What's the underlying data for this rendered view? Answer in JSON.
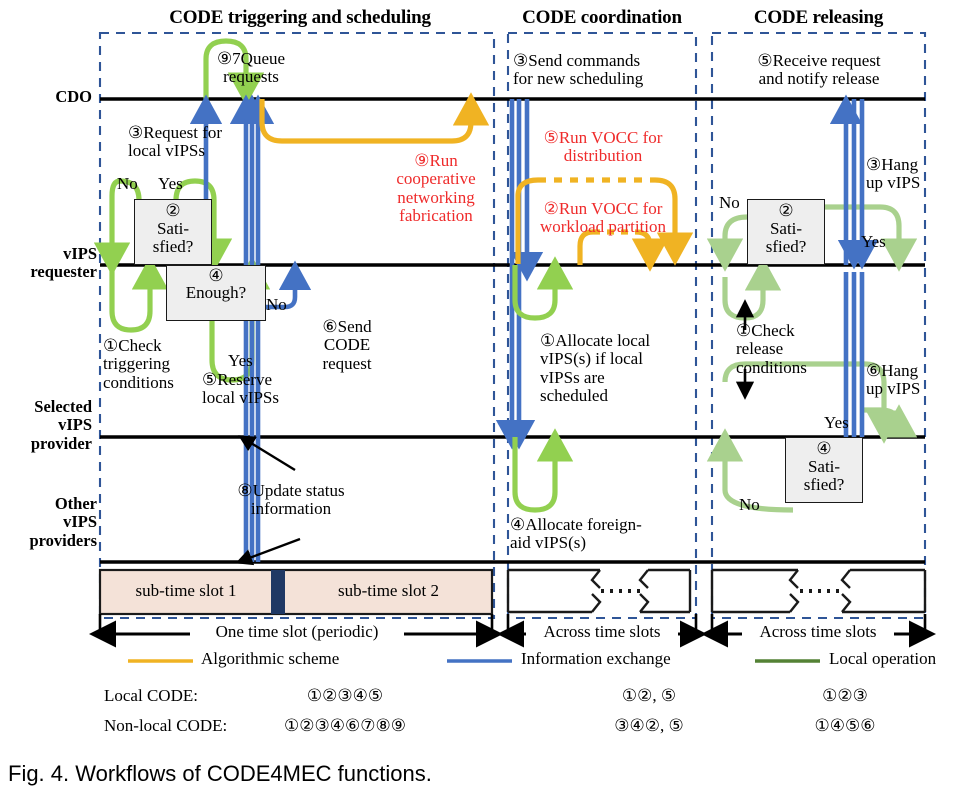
{
  "figure": {
    "caption": "Fig. 4. Workflows of CODE4MEC functions."
  },
  "colors": {
    "algorithmic": "#f0b323",
    "information": "#4472c4",
    "local_operation": "#92d050",
    "local_operation_light": "#a9d18e",
    "legend_local_operation": "#548235",
    "panel_border": "#2f5597",
    "slot_fill": "#f4e2d8",
    "slot_divider": "#1f3864",
    "red_text": "#ef2b2b",
    "line": "#000000"
  },
  "panels": [
    {
      "id": "triggering",
      "title": "CODE triggering and scheduling"
    },
    {
      "id": "coordination",
      "title": "CODE coordination"
    },
    {
      "id": "releasing",
      "title": "CODE releasing"
    }
  ],
  "lifelines": [
    {
      "id": "cdo",
      "label": "CDO"
    },
    {
      "id": "vips-requester",
      "label": "vIPS\nrequester"
    },
    {
      "id": "selected-vips-provider",
      "label": "Selected\nvIPS\nprovider"
    },
    {
      "id": "other-vips-providers",
      "label": "Other\nvIPS\nproviders"
    }
  ],
  "panel1": {
    "steps": {
      "queue_requests": "⑨7Queue\nrequests",
      "request_local_vips": "③Request for\nlocal vIPSs",
      "run_cooperative": "⑨Run\ncooperative\nnetworking\nfabrication",
      "check_triggering": "①Check\ntriggering\nconditions",
      "reserve_local": "⑤Reserve\nlocal vIPSs",
      "send_code_request": "⑥Send\nCODE\nrequest",
      "update_status": "⑧Update status\ninformation"
    },
    "decisions": [
      {
        "id": "satisfied",
        "number": "②",
        "label": "Sati-\nsfied?"
      },
      {
        "id": "enough",
        "number": "④",
        "label": "Enough?"
      }
    ],
    "branches": {
      "no1": "No",
      "yes1": "Yes",
      "yes2": "Yes",
      "no2": "No"
    }
  },
  "panel2": {
    "steps": {
      "send_commands": "③Send commands\nfor new scheduling",
      "run_vocc_distribution": "⑤Run VOCC for\ndistribution",
      "run_vocc_partition": "②Run VOCC for\nworkload partition",
      "allocate_local": "①Allocate local\nvIPS(s) if local\nvIPSs are\nscheduled",
      "allocate_foreign": "④Allocate foreign-\naid vIPS(s)"
    }
  },
  "panel3": {
    "steps": {
      "receive_request": "⑤Receive request\nand notify release",
      "hang_up_vips_3": "③Hang\nup vIPS",
      "check_release": "①Check\nrelease\nconditions",
      "hang_up_vips_6": "⑥Hang\nup vIPS"
    },
    "decisions": [
      {
        "id": "satisfied-2",
        "number": "②",
        "label": "Sati-\nsfied?"
      },
      {
        "id": "satisfied-4",
        "number": "④",
        "label": "Sati-\nsfied?"
      }
    ],
    "branches": {
      "no_top": "No",
      "yes_top": "Yes",
      "yes_bottom": "Yes",
      "no_bottom": "No"
    }
  },
  "timeline": {
    "sub_slot_1": "sub-time slot 1",
    "sub_slot_2": "sub-time slot 2",
    "one_time_slot": "One time slot (periodic)",
    "across_time_slots_2": "Across time slots",
    "across_time_slots_3": "Across time slots"
  },
  "legend": {
    "entries": [
      {
        "id": "algorithmic-scheme",
        "label": "Algorithmic scheme",
        "color": "#f0b323"
      },
      {
        "id": "information-exchange",
        "label": "Information exchange",
        "color": "#4472c4"
      },
      {
        "id": "local-operation",
        "label": "Local operation",
        "color": "#548235"
      }
    ],
    "rows": [
      {
        "id": "local-code",
        "label": "Local CODE:",
        "cols": [
          "①②③④⑤",
          "①②, ⑤",
          "①②③"
        ]
      },
      {
        "id": "non-local-code",
        "label": "Non-local CODE:",
        "cols": [
          "①②③④⑥⑦⑧⑨",
          "③④②, ⑤",
          "①④⑤⑥"
        ]
      }
    ]
  }
}
